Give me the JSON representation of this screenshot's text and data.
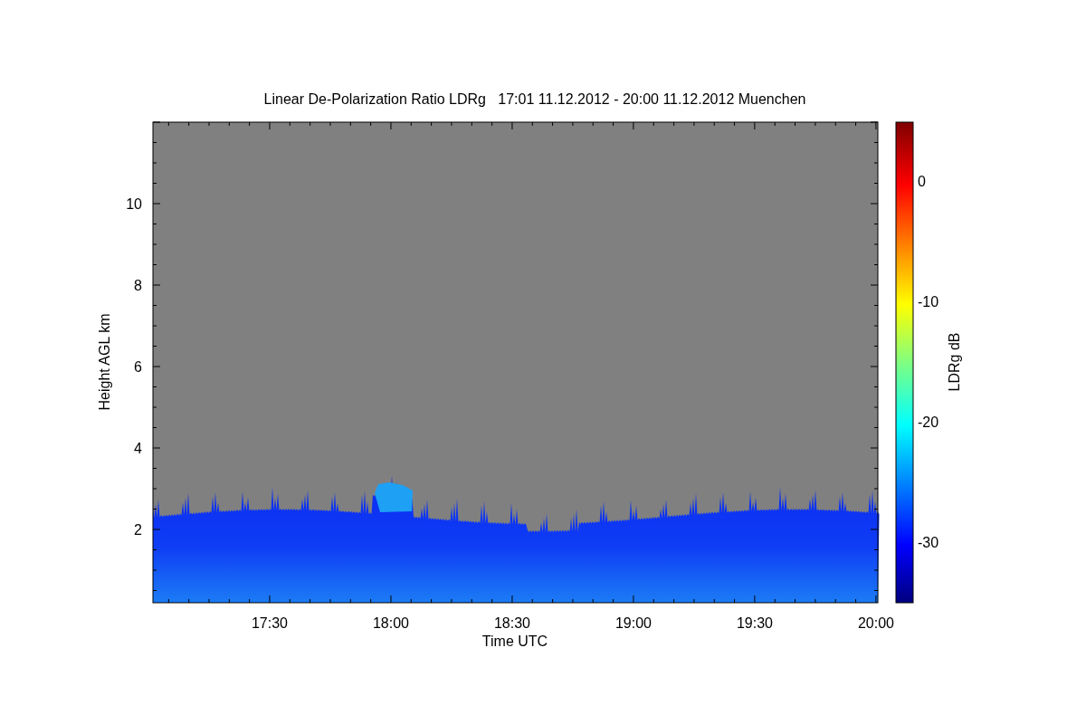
{
  "plot": {
    "title": "Linear De-Polarization Ratio LDRg   17:01 11.12.2012 - 20:00 11.12.2012 Muenchen",
    "x_axis": {
      "label": "Time UTC",
      "ticks": [
        "17:30",
        "18:00",
        "18:30",
        "19:00",
        "19:30",
        "20:00"
      ]
    },
    "y_axis": {
      "label": "Height AGL km",
      "ticks": [
        "10",
        "8",
        "6",
        "4",
        "2"
      ]
    },
    "colorbar": {
      "label": "LDRg dB",
      "ticks": [
        "0",
        "-10",
        "-20",
        "-30"
      ]
    }
  }
}
